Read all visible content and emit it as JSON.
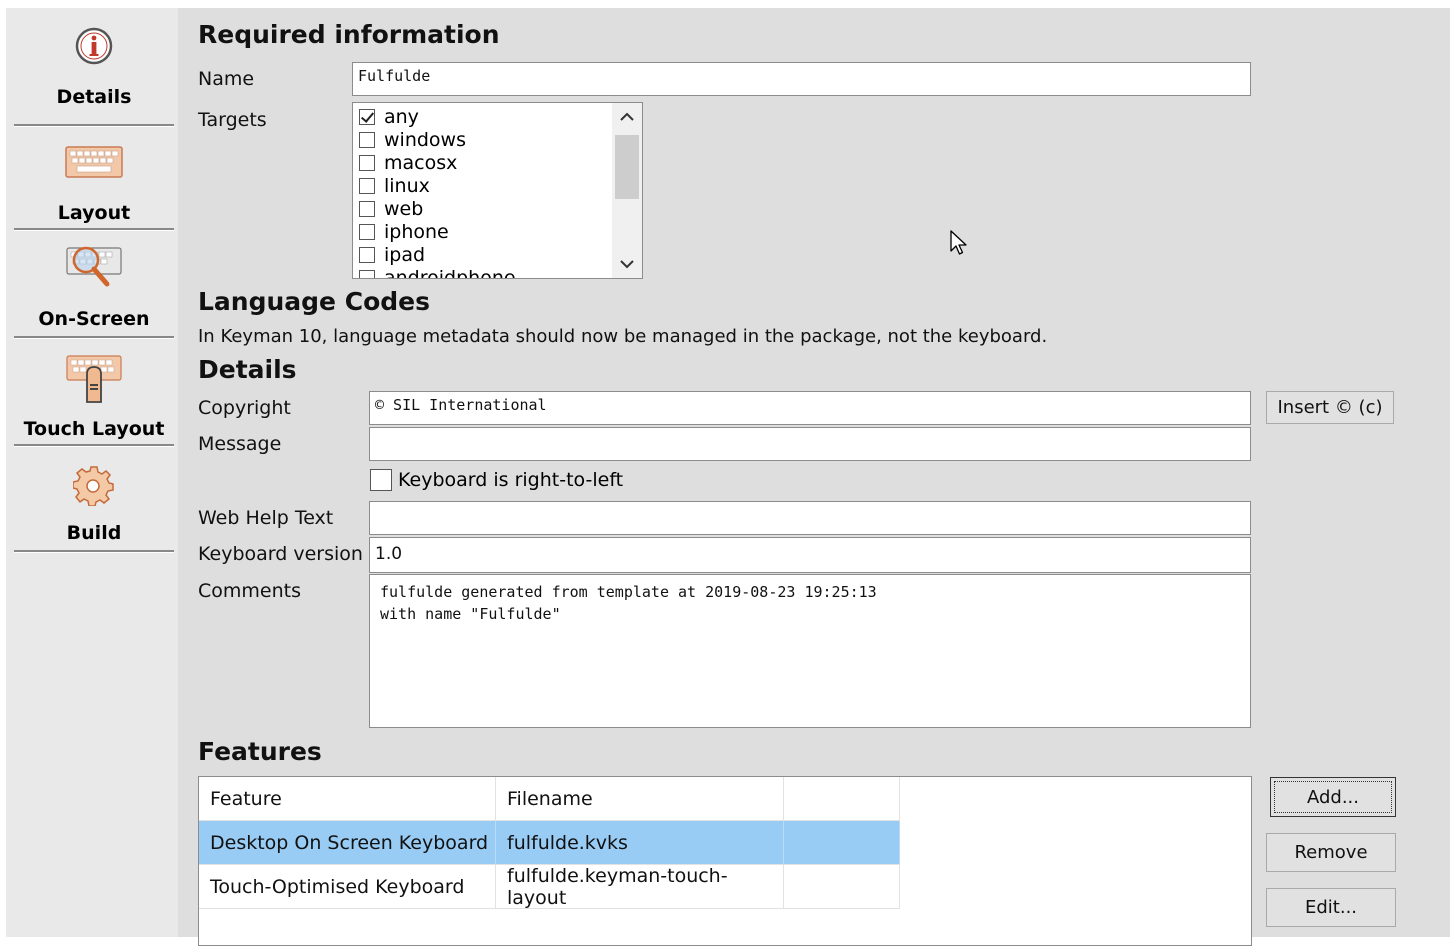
{
  "sidebar": {
    "items": [
      {
        "label": "Details",
        "icon": "info-icon"
      },
      {
        "label": "Layout",
        "icon": "keyboard-icon"
      },
      {
        "label": "On-Screen",
        "icon": "magnified-keyboard-icon"
      },
      {
        "label": "Touch Layout",
        "icon": "touch-keyboard-icon"
      },
      {
        "label": "Build",
        "icon": "gear-icon"
      }
    ]
  },
  "required": {
    "title": "Required information",
    "name_label": "Name",
    "name_value": "Fulfulde",
    "targets_label": "Targets",
    "targets": [
      {
        "label": "any",
        "checked": true
      },
      {
        "label": "windows",
        "checked": false
      },
      {
        "label": "macosx",
        "checked": false
      },
      {
        "label": "linux",
        "checked": false
      },
      {
        "label": "web",
        "checked": false
      },
      {
        "label": "iphone",
        "checked": false
      },
      {
        "label": "ipad",
        "checked": false
      },
      {
        "label": "androidphone",
        "checked": false
      }
    ]
  },
  "language_codes": {
    "title": "Language Codes",
    "note": "In Keyman 10, language metadata should now be managed in the package, not the keyboard."
  },
  "details": {
    "title": "Details",
    "copyright_label": "Copyright",
    "copyright_value": "© SIL International",
    "insert_button": "Insert © (c)",
    "message_label": "Message",
    "message_value": "",
    "rtl_label": "Keyboard is right-to-left",
    "rtl_checked": false,
    "webhelp_label": "Web Help Text",
    "webhelp_value": "",
    "version_label": "Keyboard version",
    "version_value": "1.0",
    "comments_label": "Comments",
    "comments_value": "fulfulde generated from template at 2019-08-23 19:25:13\nwith name \"Fulfulde\""
  },
  "features": {
    "title": "Features",
    "columns": [
      "Feature",
      "Filename"
    ],
    "rows": [
      {
        "feature": "Desktop On Screen Keyboard",
        "filename": "fulfulde.kvks",
        "selected": true
      },
      {
        "feature": "Touch-Optimised Keyboard",
        "filename": "fulfulde.keyman-touch-layout",
        "selected": false
      }
    ],
    "buttons": {
      "add": "Add...",
      "remove": "Remove",
      "edit": "Edit..."
    }
  },
  "colors": {
    "selection": "#99ccf5",
    "panel": "#dedede",
    "sidebar": "#e9e9e9"
  }
}
